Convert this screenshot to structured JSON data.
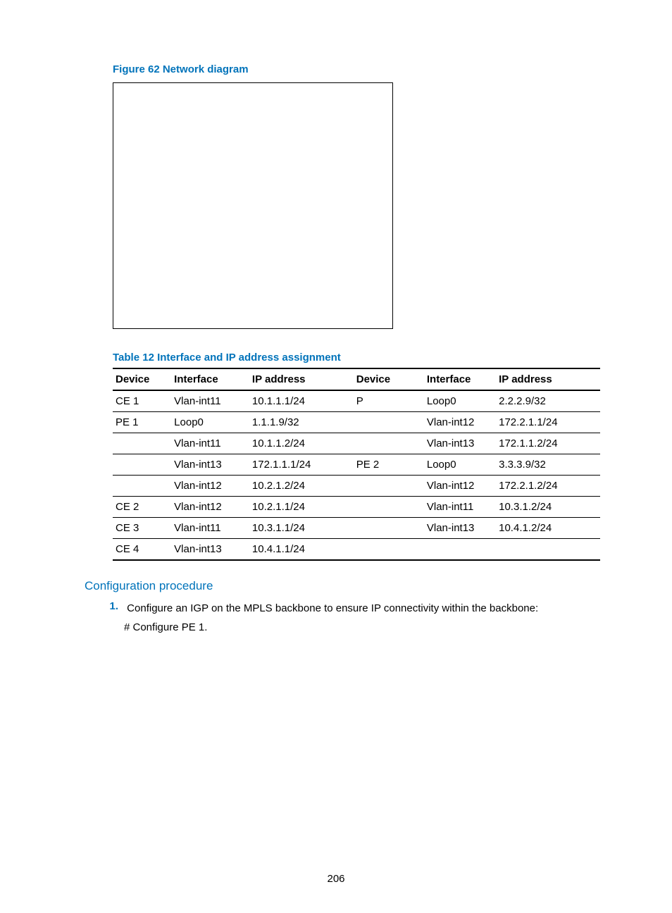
{
  "figure_caption": "Figure 62 Network diagram",
  "table_caption": "Table 12 Interface and IP address assignment",
  "headers": {
    "dev": "Device",
    "if": "Interface",
    "ip": "IP address",
    "dev2": "Device",
    "if2": "Interface",
    "ip2": "IP address"
  },
  "rows": [
    {
      "dev": "CE 1",
      "if": "Vlan-int11",
      "ip": "10.1.1.1/24",
      "dev2": "P",
      "if2": "Loop0",
      "ip2": "2.2.2.9/32"
    },
    {
      "dev": "PE 1",
      "if": "Loop0",
      "ip": "1.1.1.9/32",
      "dev2": "",
      "if2": "Vlan-int12",
      "ip2": "172.2.1.1/24"
    },
    {
      "dev": "",
      "if": "Vlan-int11",
      "ip": "10.1.1.2/24",
      "dev2": "",
      "if2": "Vlan-int13",
      "ip2": "172.1.1.2/24"
    },
    {
      "dev": "",
      "if": "Vlan-int13",
      "ip": "172.1.1.1/24",
      "dev2": "PE 2",
      "if2": "Loop0",
      "ip2": "3.3.3.9/32"
    },
    {
      "dev": "",
      "if": "Vlan-int12",
      "ip": "10.2.1.2/24",
      "dev2": "",
      "if2": "Vlan-int12",
      "ip2": "172.2.1.2/24"
    },
    {
      "dev": "CE 2",
      "if": "Vlan-int12",
      "ip": "10.2.1.1/24",
      "dev2": "",
      "if2": "Vlan-int11",
      "ip2": "10.3.1.2/24"
    },
    {
      "dev": "CE 3",
      "if": "Vlan-int11",
      "ip": "10.3.1.1/24",
      "dev2": "",
      "if2": "Vlan-int13",
      "ip2": "10.4.1.2/24"
    },
    {
      "dev": "CE 4",
      "if": "Vlan-int13",
      "ip": "10.4.1.1/24",
      "dev2": "",
      "if2": "",
      "ip2": ""
    }
  ],
  "section_head": "Configuration procedure",
  "step_num": "1.",
  "step_text": "Configure an IGP on the MPLS backbone to ensure IP connectivity within the backbone:",
  "step_sub": "# Configure PE 1.",
  "page_num": "206"
}
